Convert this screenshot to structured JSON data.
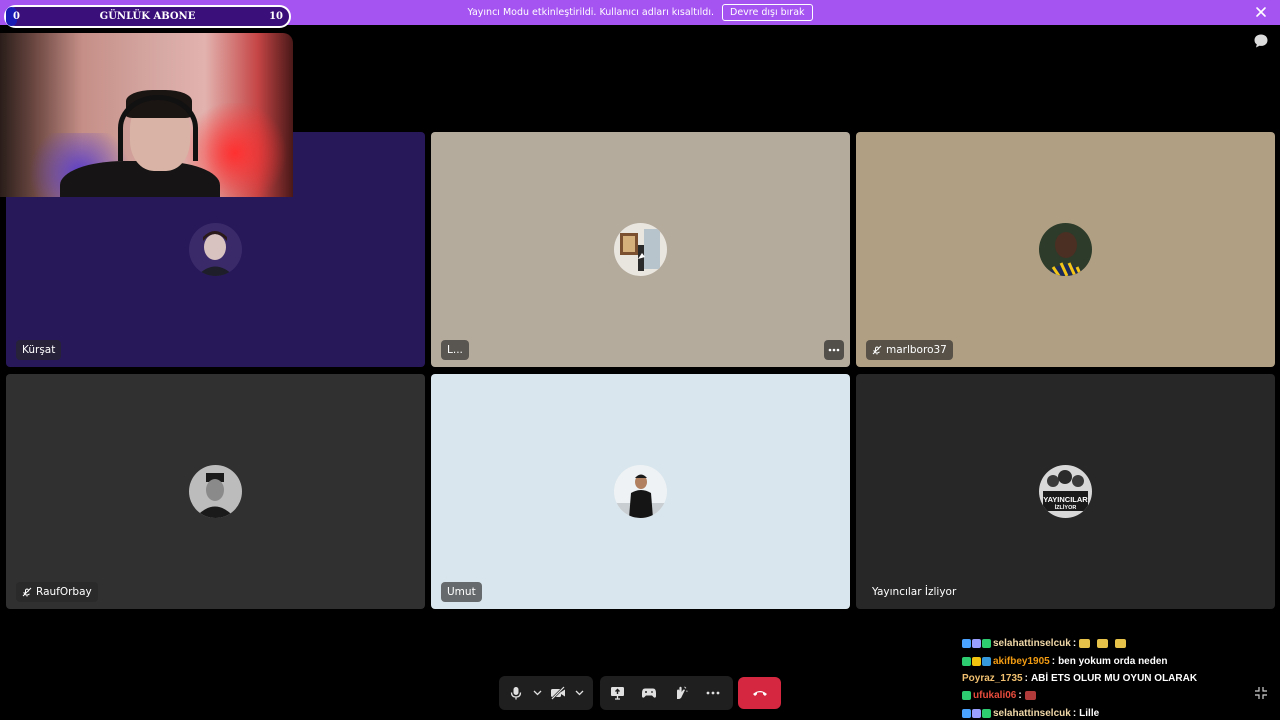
{
  "banner": {
    "text": "Yayıncı Modu etkinleştirildi. Kullanıcı adları kısaltıldı.",
    "button": "Devre dışı bırak",
    "color": "#a553f1"
  },
  "sub_goal": {
    "title": "GÜNLÜK ABONE",
    "start": "0",
    "end": "10",
    "progress": 0.04
  },
  "tiles": [
    {
      "name": "Kürşat",
      "muted": false,
      "bg": "#27185a"
    },
    {
      "name": "L...",
      "muted": false,
      "bg": "#b5ab9d",
      "has_menu": true
    },
    {
      "name": "marlboro37",
      "muted": true,
      "bg": "#b09f83"
    },
    {
      "name": "RaufOrbay",
      "muted": true,
      "bg": "#303030"
    },
    {
      "name": "Umut",
      "muted": false,
      "bg": "#d9e6ed"
    },
    {
      "name": "Yayıncılar İzliyor",
      "muted": false,
      "bg": "#272727"
    }
  ],
  "avatar_texts": {
    "yayincilar_line1": "YAYINCILAR",
    "yayincilar_line2": "İZLİYOR"
  },
  "controls": {
    "icons": [
      "microphone-icon",
      "chevron-up-icon",
      "camera-off-icon",
      "chevron-up-icon",
      "screen-share-icon",
      "activity-icon",
      "soundboard-icon",
      "more-icon"
    ],
    "hangup_color": "#d5273f"
  },
  "chat": [
    {
      "user": "selahattinselcuk",
      "user_color": "#f0d8a8",
      "message": "",
      "emotes": 3,
      "badges": [
        "#4aa3ff",
        "#9aa0ff",
        "#2ecc71"
      ]
    },
    {
      "user": "akifbey1905",
      "user_color": "#f39c12",
      "message": "ben yokum orda neden",
      "emotes": 0,
      "badges": [
        "#2ecc71",
        "#f1c40f",
        "#3498db"
      ]
    },
    {
      "user": "Poyraz_1735",
      "user_color": "#f0c070",
      "message": "ABİ ETS OLUR MU OYUN OLARAK",
      "emotes": 0,
      "badges": []
    },
    {
      "user": "ufukali06",
      "user_color": "#e74c3c",
      "message": "",
      "emotes": 1,
      "badges": [
        "#2ecc71"
      ]
    },
    {
      "user": "selahattinselcuk",
      "user_color": "#f0d8a8",
      "message": "Lille",
      "emotes": 0,
      "badges": [
        "#4aa3ff",
        "#9aa0ff",
        "#2ecc71"
      ]
    }
  ],
  "chat_separator": ":"
}
